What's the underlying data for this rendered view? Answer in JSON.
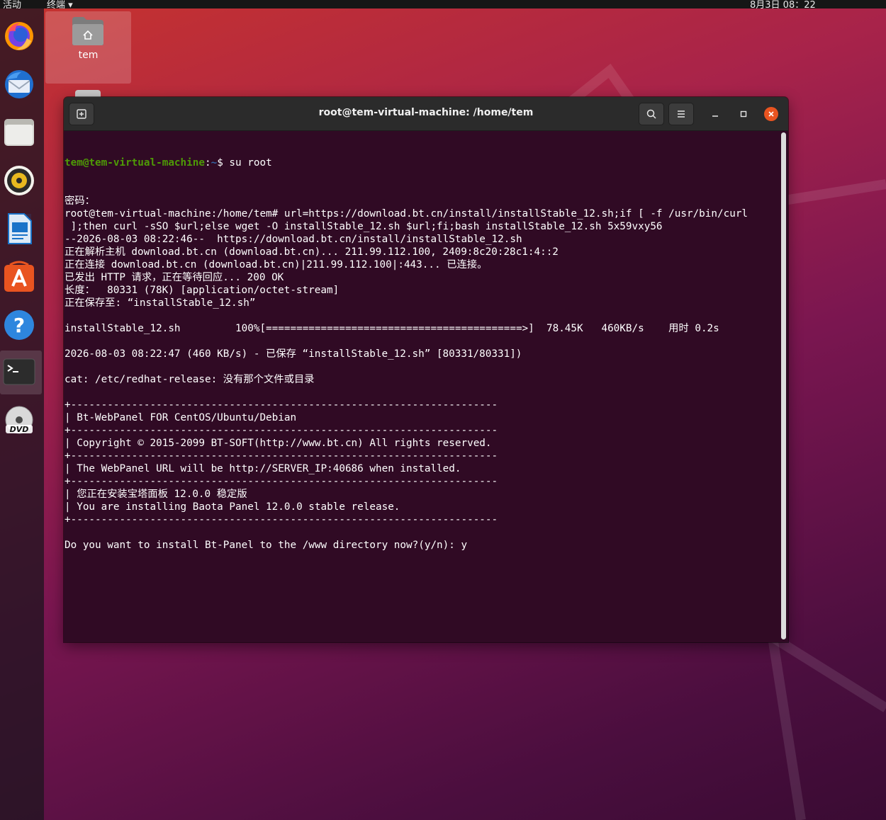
{
  "topbar": {
    "activities": "活动",
    "app_menu": "终端 ▾",
    "clock": "8月3日 08：22"
  },
  "dock": {
    "items": [
      {
        "name": "firefox",
        "icon": "firefox-icon"
      },
      {
        "name": "thunderbird",
        "icon": "thunderbird-icon"
      },
      {
        "name": "files",
        "icon": "folder-icon"
      },
      {
        "name": "rhythmbox",
        "icon": "speaker-icon"
      },
      {
        "name": "libreoffice-writer",
        "icon": "document-icon"
      },
      {
        "name": "ubuntu-software",
        "icon": "app-store-icon"
      },
      {
        "name": "help",
        "icon": "help-icon"
      },
      {
        "name": "terminal",
        "icon": "terminal-icon",
        "active": true
      },
      {
        "name": "dvd",
        "icon": "dvd-icon",
        "label": "DVD"
      }
    ]
  },
  "desktop": {
    "folder_label": "tem"
  },
  "terminal": {
    "title": "root@tem-virtual-machine: /home/tem",
    "prompt_user": "tem@tem-virtual-machine",
    "prompt_sep": ":",
    "prompt_path": "~",
    "prompt_cmd": "$ su root",
    "lines": [
      "密码：",
      "root@tem-virtual-machine:/home/tem# url=https://download.bt.cn/install/installStable_12.sh;if [ -f /usr/bin/curl",
      " ];then curl -sSO $url;else wget -O installStable_12.sh $url;fi;bash installStable_12.sh 5x59vxy56",
      "--2026-08-03 08:22:46--  https://download.bt.cn/install/installStable_12.sh",
      "正在解析主机 download.bt.cn (download.bt.cn)... 211.99.112.100, 2409:8c20:28c1:4::2",
      "正在连接 download.bt.cn (download.bt.cn)|211.99.112.100|:443... 已连接。",
      "已发出 HTTP 请求，正在等待回应... 200 OK",
      "长度：  80331 (78K) [application/octet-stream]",
      "正在保存至: “installStable_12.sh”",
      "",
      "installStable_12.sh         100%[==========================================>]  78.45K   460KB/s    用时 0.2s",
      "",
      "2026-08-03 08:22:47 (460 KB/s) - 已保存 “installStable_12.sh” [80331/80331])",
      "",
      "cat: /etc/redhat-release: 没有那个文件或目录",
      "",
      "+----------------------------------------------------------------------",
      "| Bt-WebPanel FOR CentOS/Ubuntu/Debian",
      "+----------------------------------------------------------------------",
      "| Copyright © 2015-2099 BT-SOFT(http://www.bt.cn) All rights reserved.",
      "+----------------------------------------------------------------------",
      "| The WebPanel URL will be http://SERVER_IP:40686 when installed.",
      "+----------------------------------------------------------------------",
      "| 您正在安装宝塔面板 12.0.0 稳定版",
      "| You are installing Baota Panel 12.0.0 stable release.",
      "+----------------------------------------------------------------------",
      "",
      "Do you want to install Bt-Panel to the /www directory now?(y/n): y"
    ]
  },
  "colors": {
    "terminal_bg": "#300a24",
    "prompt_user": "#4e9a06",
    "prompt_path": "#3465a4",
    "accent_close": "#e95420"
  }
}
